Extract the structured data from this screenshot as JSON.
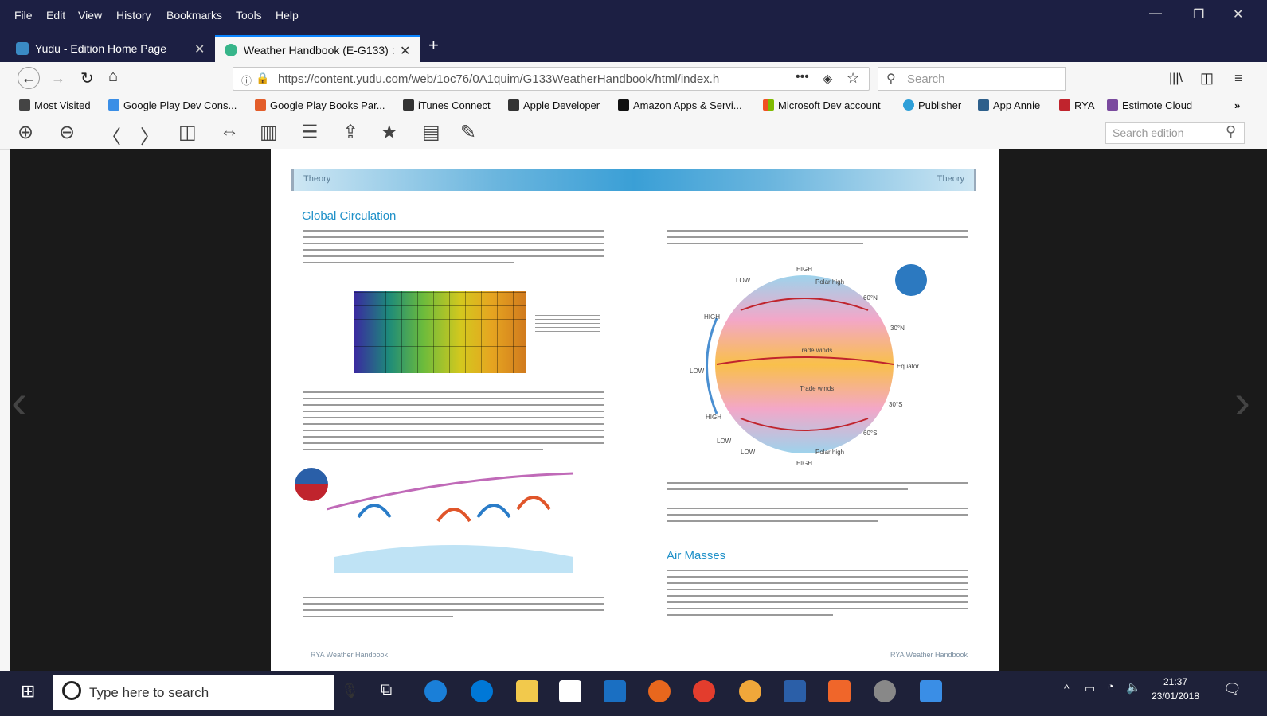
{
  "menu": {
    "items": [
      "File",
      "Edit",
      "View",
      "History",
      "Bookmarks",
      "Tools",
      "Help"
    ]
  },
  "tabs": [
    {
      "label": "Yudu - Edition Home Page",
      "icon": "yudu-icon"
    },
    {
      "label": "Weather Handbook (E-G133) :",
      "icon": "globe-icon",
      "active": true
    }
  ],
  "nav": {
    "url": "https://content.yudu.com/web/1oc76/0A1quim/G133WeatherHandbook/html/index.h",
    "search_placeholder": "Search"
  },
  "bookmarks": [
    {
      "label": "Most Visited",
      "icon": "gear-icon",
      "color": "#444444"
    },
    {
      "label": "Google Play Dev Cons...",
      "icon": "play-icon",
      "color": "#3a8ee6"
    },
    {
      "label": "Google Play Books Par...",
      "icon": "books-icon",
      "color": "#e35d2a"
    },
    {
      "label": "iTunes Connect",
      "icon": "apple-icon",
      "color": "#333333"
    },
    {
      "label": "Apple Developer",
      "icon": "apple-icon",
      "color": "#333333"
    },
    {
      "label": "Amazon Apps & Servi...",
      "icon": "amazon-icon",
      "color": "#111111"
    },
    {
      "label": "Microsoft Dev account",
      "icon": "windows-icon",
      "color": "#f25022"
    },
    {
      "label": "Publisher",
      "icon": "globe-icon",
      "color": "#2e9fd8"
    },
    {
      "label": "App Annie",
      "icon": "appannie-icon",
      "color": "#2d5f8b"
    },
    {
      "label": "RYA",
      "icon": "rya-icon",
      "color": "#c0242d"
    },
    {
      "label": "Estimote Cloud",
      "icon": "estimote-icon",
      "color": "#7a4a9e"
    }
  ],
  "yudu_toolbar": {
    "search_placeholder": "Search edition"
  },
  "page_left": {
    "running_head": "Theory",
    "heading": "Global Circulation",
    "footer": "RYA Weather Handbook"
  },
  "page_right": {
    "running_head": "Theory",
    "heading": "Air Masses",
    "footer": "RYA Weather Handbook"
  },
  "diagram": {
    "labels": [
      "HIGH",
      "LOW",
      "Polar high",
      "60°N",
      "30°N",
      "Trade winds",
      "Equator",
      "Trade winds",
      "30°S",
      "60°S",
      "Polar high",
      "LOW",
      "HIGH",
      "HIGH",
      "LOW",
      "HIGH",
      "LOW"
    ]
  },
  "taskbar": {
    "search_placeholder": "Type here to search",
    "time": "21:37",
    "date": "23/01/2018"
  }
}
